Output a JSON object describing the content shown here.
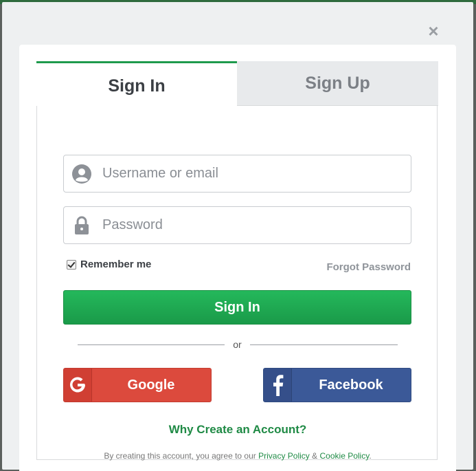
{
  "modal": {
    "close_glyph": "×"
  },
  "tabs": [
    {
      "label": "Sign In",
      "active": true
    },
    {
      "label": "Sign Up",
      "active": false
    }
  ],
  "form": {
    "username_placeholder": "Username or email",
    "username_value": "",
    "password_placeholder": "Password",
    "password_value": "",
    "remember_label": "Remember me",
    "remember_checked": true,
    "forgot_label": "Forgot Password",
    "submit_label": "Sign In",
    "divider_text": "or"
  },
  "social": {
    "google_label": "Google",
    "facebook_label": "Facebook"
  },
  "footer": {
    "why_label": "Why Create an Account?",
    "terms_prefix": "By creating this account, you agree to our",
    "privacy_label": "Privacy Policy",
    "amp": "&",
    "cookie_label": "Cookie Policy",
    "terms_suffix": "."
  },
  "icons": {
    "user": "user-icon",
    "lock": "lock-icon",
    "google": "google-icon",
    "facebook": "facebook-icon",
    "close": "close-icon"
  },
  "colors": {
    "accent_green": "#1e9a4c",
    "google_red": "#dc4a3d",
    "facebook_blue": "#3b5998"
  }
}
